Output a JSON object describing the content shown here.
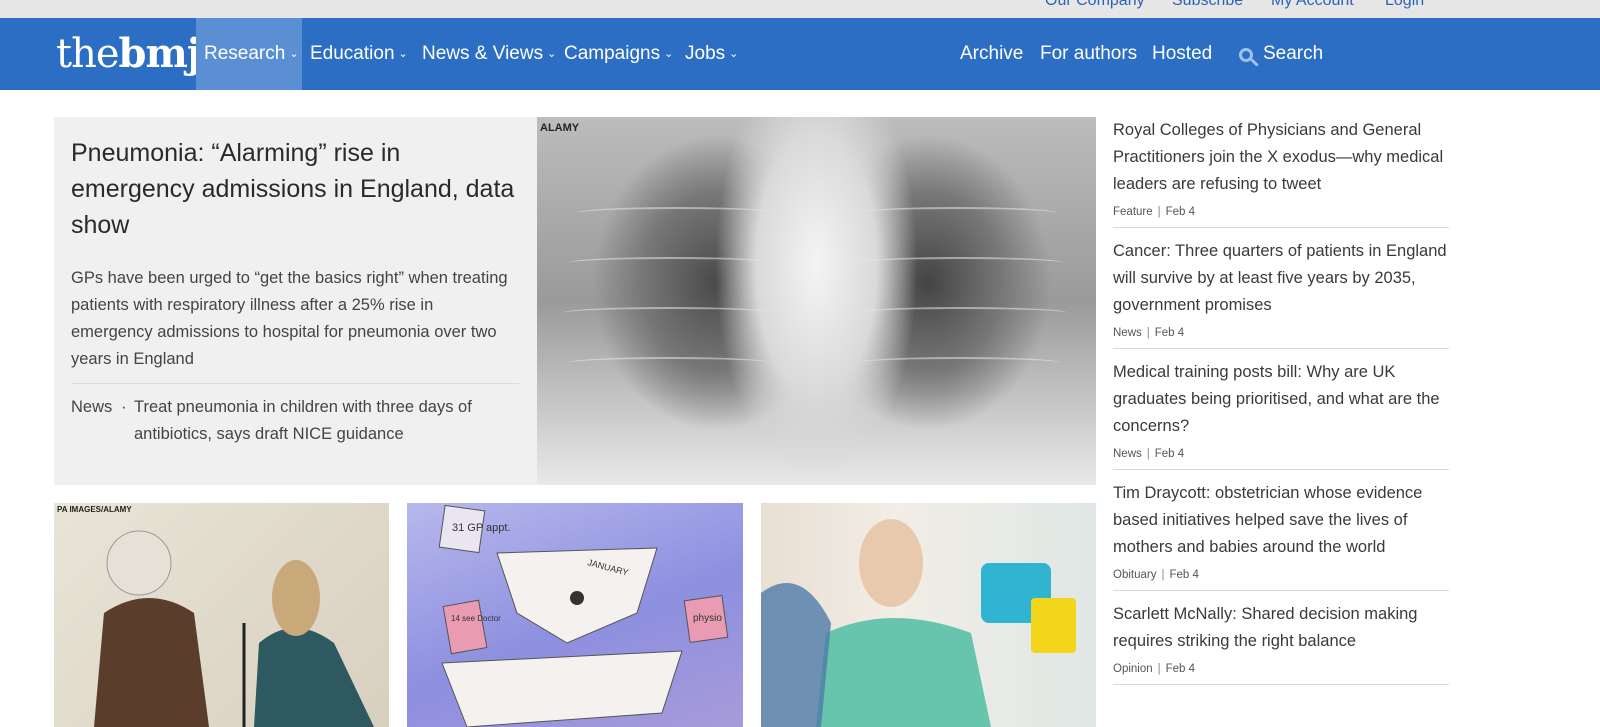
{
  "topbar": {
    "links": [
      "Our Company",
      "Subscribe",
      "My Account",
      "Login"
    ]
  },
  "nav": {
    "logo_the": "the",
    "logo_bmj": "bmj",
    "items": [
      {
        "label": "Research"
      },
      {
        "label": "Education"
      },
      {
        "label": "News & Views"
      },
      {
        "label": "Campaigns"
      },
      {
        "label": "Jobs"
      }
    ],
    "right_items": [
      "Archive",
      "For authors",
      "Hosted"
    ],
    "search_label": "Search"
  },
  "lead": {
    "title": "Pneumonia: “Alarming” rise in emergency admissions in England, data show",
    "summary": "GPs have been urged to “get the basics right” when treating patients with respiratory illness after a 25% rise in emergency admissions to hospital for pneumonia over two years in England",
    "related": {
      "type": "News",
      "separator": "·",
      "title": "Treat pneumonia in children with three days of antibiotics, says draft NICE guidance"
    },
    "image_credit": "ALAMY"
  },
  "cards": [
    {
      "image_credit": "PA IMAGES/ALAMY",
      "image": "courtroom-sketch"
    },
    {
      "image": "calendar-illustration",
      "notes": [
        "31 GP appt.",
        "JANUARY",
        "14 see Doctor",
        "physio"
      ]
    },
    {
      "image": "nurse-patient-photo"
    }
  ],
  "sidebar": {
    "items": [
      {
        "title": "Royal Colleges of Physicians and General Practitioners join the X exodus—why medical leaders are refusing to tweet",
        "type": "Feature",
        "date": "Feb 4"
      },
      {
        "title": "Cancer: Three quarters of patients in England will survive by at least five years by 2035, government promises",
        "type": "News",
        "date": "Feb 4"
      },
      {
        "title": "Medical training posts bill: Why are UK graduates being prioritised, and what are the concerns?",
        "type": "News",
        "date": "Feb 4"
      },
      {
        "title": "Tim Draycott: obstetrician whose evidence based initiatives helped save the lives of mothers and babies around the world",
        "type": "Obituary",
        "date": "Feb 4"
      },
      {
        "title": "Scarlett McNally: Shared decision making requires striking the right balance",
        "type": "Opinion",
        "date": "Feb 4"
      }
    ],
    "meta_separator": "|"
  },
  "colors": {
    "nav_bg": "#2c6ec4",
    "nav_active": "#5b8fd4",
    "lead_bg": "#f0f0f0",
    "topbar_link": "#2b63b8"
  }
}
